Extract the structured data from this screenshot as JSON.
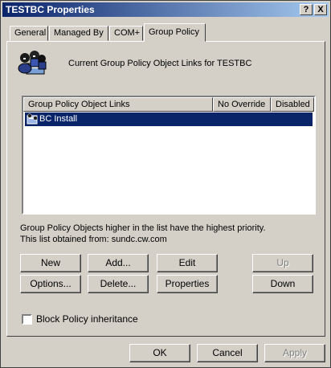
{
  "window": {
    "title": "TESTBC Properties"
  },
  "titlebar_buttons": {
    "help": "?",
    "close": "X"
  },
  "tabs": [
    {
      "label": "General",
      "active": false
    },
    {
      "label": "Managed By",
      "active": false
    },
    {
      "label": "COM+",
      "active": false
    },
    {
      "label": "Group Policy",
      "active": true
    }
  ],
  "header": {
    "text": "Current Group Policy Object Links for TESTBC"
  },
  "list": {
    "columns": [
      "Group Policy Object Links",
      "No Override",
      "Disabled"
    ],
    "rows": [
      {
        "name": "BC Install",
        "selected": true
      }
    ]
  },
  "info": {
    "line1": "Group Policy Objects higher in the list have the highest priority.",
    "line2": "This list obtained from: sundc.cw.com"
  },
  "buttons": {
    "new": "New",
    "add": "Add...",
    "edit": "Edit",
    "up": "Up",
    "options": "Options...",
    "delete": "Delete...",
    "properties": "Properties",
    "down": "Down"
  },
  "block_inheritance": {
    "label": "Block Policy inheritance",
    "checked": false
  },
  "dialog_buttons": {
    "ok": "OK",
    "cancel": "Cancel",
    "apply": "Apply"
  }
}
